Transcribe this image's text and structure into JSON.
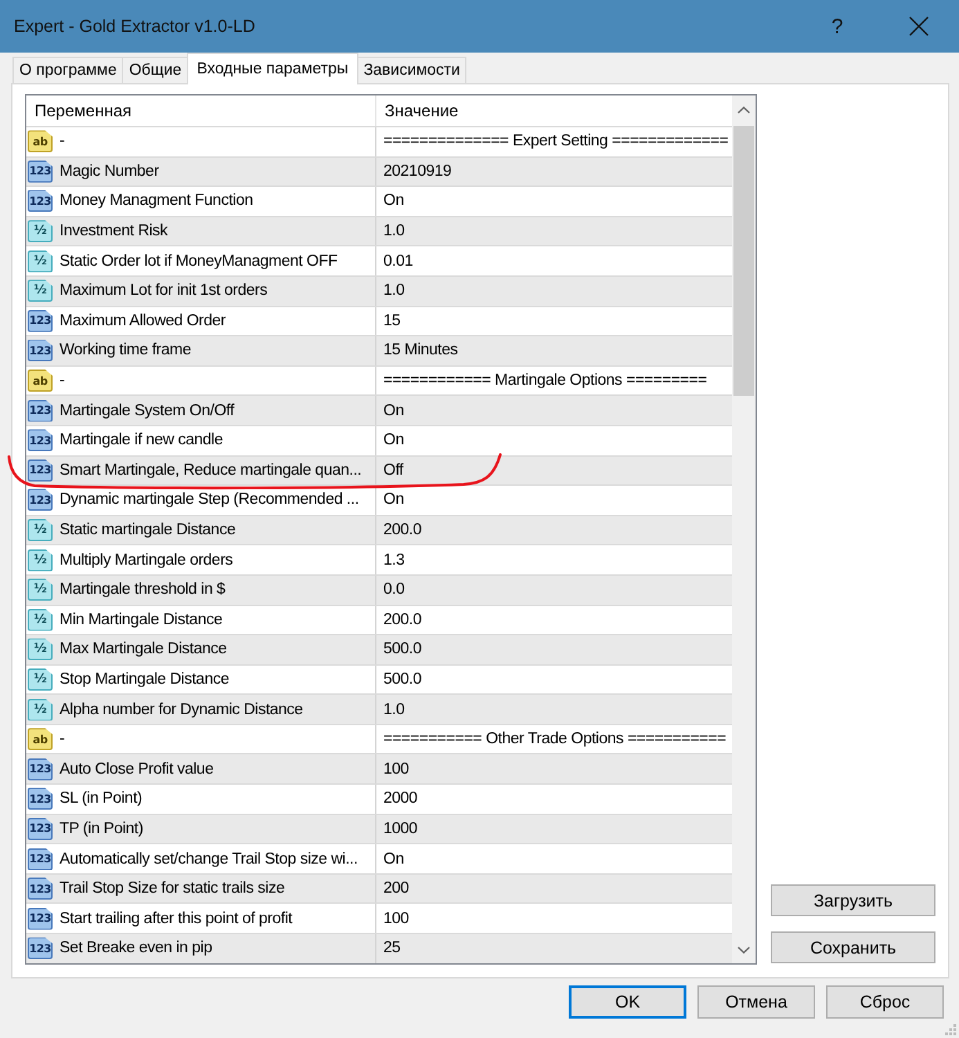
{
  "window": {
    "title": "Expert - Gold Extractor v1.0-LD",
    "help": "?"
  },
  "tabs": [
    {
      "label": "О программе",
      "selected": false
    },
    {
      "label": "Общие",
      "selected": false
    },
    {
      "label": "Входные параметры",
      "selected": true
    },
    {
      "label": "Зависимости",
      "selected": false
    }
  ],
  "table": {
    "columns": [
      "Переменная",
      "Значение"
    ],
    "rows": [
      {
        "kind": "string",
        "type_label": "ab",
        "variable": "-",
        "value": "============== Expert Setting =============",
        "marked": false
      },
      {
        "kind": "int",
        "type_label": "123",
        "variable": "Magic Number",
        "value": "20210919",
        "marked": false
      },
      {
        "kind": "int",
        "type_label": "123",
        "variable": "Money Managment Function",
        "value": "On",
        "marked": false
      },
      {
        "kind": "double",
        "type_label": "½",
        "variable": "Investment Risk",
        "value": "1.0",
        "marked": false
      },
      {
        "kind": "double",
        "type_label": "½",
        "variable": "Static Order lot if MoneyManagment OFF",
        "value": "0.01",
        "marked": false
      },
      {
        "kind": "double",
        "type_label": "½",
        "variable": "Maximum Lot for init 1st orders",
        "value": "1.0",
        "marked": false
      },
      {
        "kind": "int",
        "type_label": "123",
        "variable": "Maximum Allowed Order",
        "value": "15",
        "marked": false
      },
      {
        "kind": "int",
        "type_label": "123",
        "variable": "Working time frame",
        "value": "15 Minutes",
        "marked": false
      },
      {
        "kind": "string",
        "type_label": "ab",
        "variable": "-",
        "value": "============ Martingale Options =========",
        "marked": false
      },
      {
        "kind": "int",
        "type_label": "123",
        "variable": "Martingale System On/Off",
        "value": "On",
        "marked": false
      },
      {
        "kind": "int",
        "type_label": "123",
        "variable": "Martingale if new candle",
        "value": "On",
        "marked": false
      },
      {
        "kind": "int",
        "type_label": "123",
        "variable": "Smart Martingale, Reduce martingale quan...",
        "value": "Off",
        "marked": true
      },
      {
        "kind": "int",
        "type_label": "123",
        "variable": "Dynamic martingale Step (Recommended ...",
        "value": "On",
        "marked": false
      },
      {
        "kind": "double",
        "type_label": "½",
        "variable": "Static martingale Distance",
        "value": "200.0",
        "marked": false
      },
      {
        "kind": "double",
        "type_label": "½",
        "variable": "Multiply Martingale orders",
        "value": "1.3",
        "marked": false
      },
      {
        "kind": "double",
        "type_label": "½",
        "variable": "Martingale threshold in $",
        "value": "0.0",
        "marked": false
      },
      {
        "kind": "double",
        "type_label": "½",
        "variable": "Min Martingale Distance",
        "value": "200.0",
        "marked": false
      },
      {
        "kind": "double",
        "type_label": "½",
        "variable": "Max Martingale Distance",
        "value": "500.0",
        "marked": false
      },
      {
        "kind": "double",
        "type_label": "½",
        "variable": "Stop Martingale Distance",
        "value": "500.0",
        "marked": false
      },
      {
        "kind": "double",
        "type_label": "½",
        "variable": "Alpha number for Dynamic Distance",
        "value": "1.0",
        "marked": false
      },
      {
        "kind": "string",
        "type_label": "ab",
        "variable": "-",
        "value": "=========== Other Trade Options ===========",
        "marked": false
      },
      {
        "kind": "int",
        "type_label": "123",
        "variable": "Auto Close Profit value",
        "value": "100",
        "marked": false
      },
      {
        "kind": "int",
        "type_label": "123",
        "variable": "SL (in Point)",
        "value": "2000",
        "marked": false
      },
      {
        "kind": "int",
        "type_label": "123",
        "variable": "TP (in Point)",
        "value": "1000",
        "marked": false
      },
      {
        "kind": "int",
        "type_label": "123",
        "variable": "Automatically set/change Trail Stop size wi...",
        "value": "On",
        "marked": false
      },
      {
        "kind": "int",
        "type_label": "123",
        "variable": "Trail Stop Size for static trails size",
        "value": "200",
        "marked": false
      },
      {
        "kind": "int",
        "type_label": "123",
        "variable": "Start trailing after this point of profit",
        "value": "100",
        "marked": false
      },
      {
        "kind": "int",
        "type_label": "123",
        "variable": "Set Breake even in pip",
        "value": "25",
        "marked": false
      }
    ]
  },
  "side_buttons": [
    "Загрузить",
    "Сохранить"
  ],
  "buttons": [
    {
      "label": "OK",
      "default": true
    },
    {
      "label": "Отмена",
      "default": false
    },
    {
      "label": "Сброс",
      "default": false
    }
  ]
}
